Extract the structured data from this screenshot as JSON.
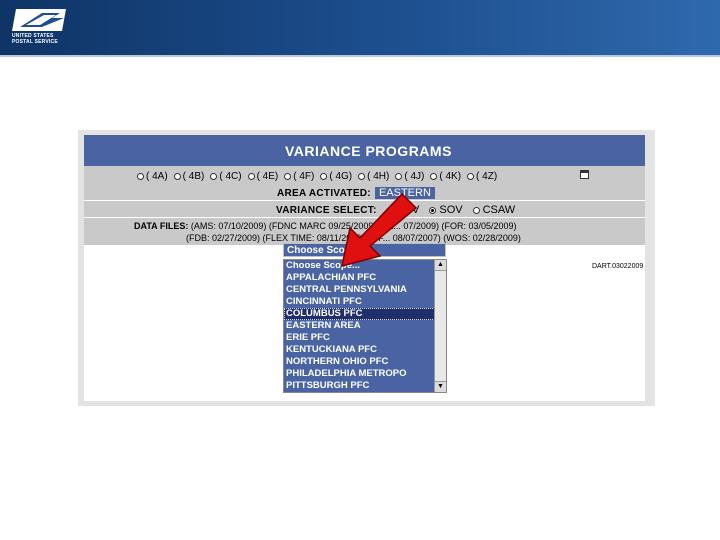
{
  "banner": {
    "logo_line1": "UNITED STATES",
    "logo_line2": "POSTAL SERVICE"
  },
  "app": {
    "title": "VARIANCE PROGRAMS",
    "programs": [
      "( 4A)",
      "( 4B)",
      "( 4C)",
      "( 4E)",
      "( 4F)",
      "( 4G)",
      "( 4H)",
      "( 4J)",
      "( 4K)",
      "( 4Z)"
    ],
    "area_label": "AREA ACTIVATED:",
    "area_value": "EASTERN",
    "variance_label": "VARIANCE SELECT:",
    "variance_options": [
      "CSV",
      "SOV",
      "CSAW"
    ],
    "variance_selected": "SOV",
    "data_files_line1": "(AMS: 07/10/2009) (FDNC MARC 09/25/2009) (FE... 07/2009) (FOR: 03/05/2009)",
    "data_files_label": "DATA FILES:",
    "data_files_line2": "(FDB: 02/27/2009) (FLEX TIME: 08/11/2009) (WF... 08/07/2007) (WOS: 02/28/2009)",
    "dart_ref": "DART.03022009"
  },
  "scope": {
    "placeholder": "Choose Scope...",
    "options": [
      "Choose Scope...",
      "APPALACHIAN PFC",
      "CENTRAL PENNSYLVANIA",
      "CINCINNATI PFC",
      "COLUMBUS PFC",
      "EASTERN AREA",
      "ERIE PFC",
      "KENTUCKIANA PFC",
      "NORTHERN OHIO PFC",
      "PHILADELPHIA METROPO",
      "PITTSBURGH PFC"
    ],
    "highlighted": "COLUMBUS PFC"
  },
  "colors": {
    "banner": "#1d4f8f",
    "header": "#4a64a3",
    "arrow": "#e01010"
  }
}
